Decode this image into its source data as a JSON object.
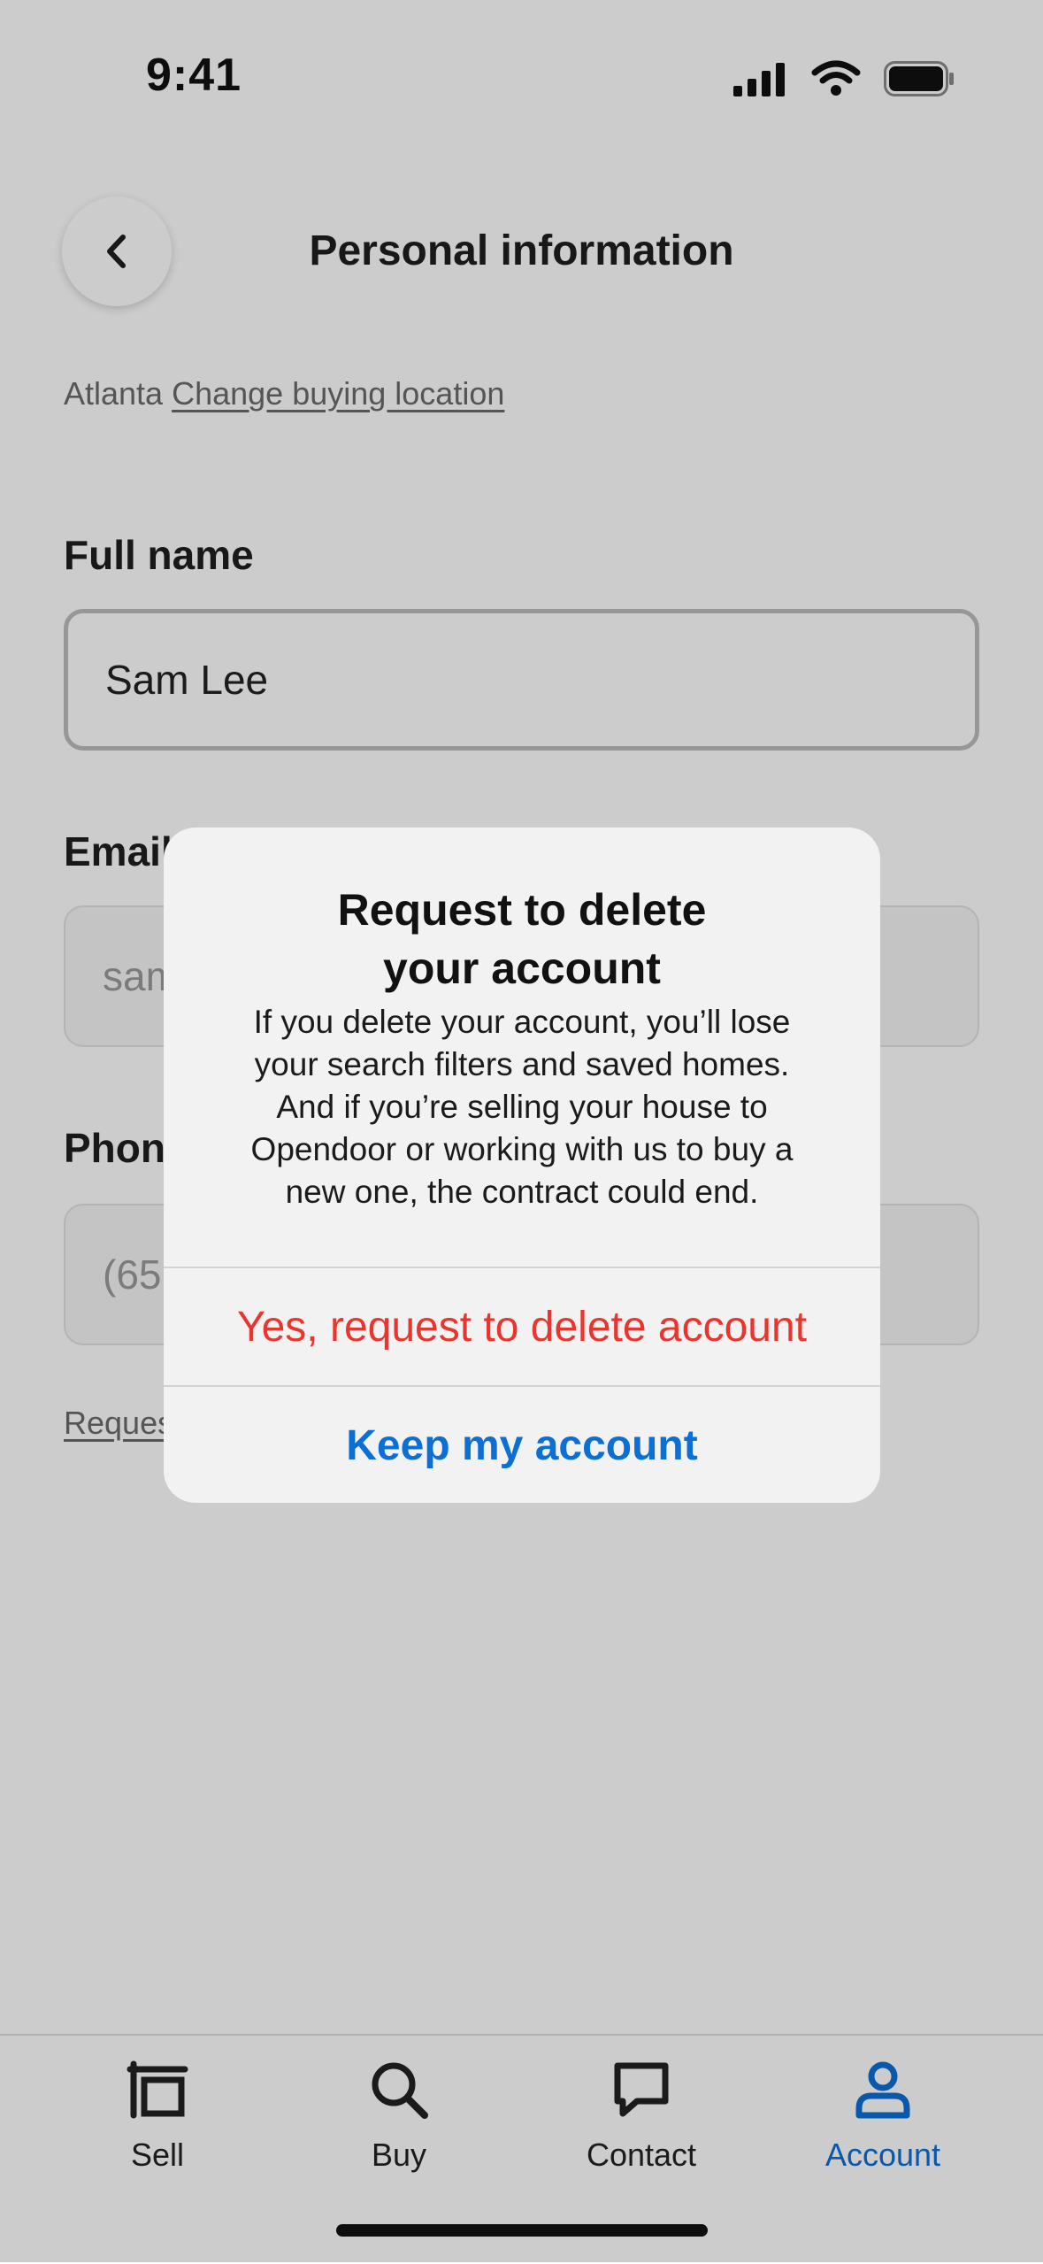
{
  "status_bar": {
    "time": "9:41",
    "icons": [
      "cellular-signal-icon",
      "wifi-icon",
      "battery-icon"
    ]
  },
  "header": {
    "back_icon": "chevron-left-icon",
    "title": "Personal information"
  },
  "location": {
    "city": "Atlanta",
    "change_link": "Change buying location"
  },
  "form": {
    "full_name": {
      "label": "Full name",
      "value": "Sam Lee"
    },
    "email": {
      "label": "Email",
      "value": "sam"
    },
    "phone": {
      "label": "Phone",
      "value": "(65"
    }
  },
  "request_link": "Reques",
  "tabs": [
    {
      "label": "Sell",
      "icon": "sell-icon",
      "active": false
    },
    {
      "label": "Buy",
      "icon": "search-icon",
      "active": false
    },
    {
      "label": "Contact",
      "icon": "chat-bubble-icon",
      "active": false
    },
    {
      "label": "Account",
      "icon": "person-icon",
      "active": true
    }
  ],
  "dialog": {
    "title_line1": "Request to delete",
    "title_line2": "your account",
    "message_lines": [
      "If you delete your account, you’ll lose",
      "your search filters and saved homes.",
      "And if you’re selling your house to",
      "Opendoor or working with us to buy a",
      "new one, the contract could end."
    ],
    "destructive_label": "Yes, request to delete account",
    "primary_label": "Keep my account"
  },
  "colors": {
    "accent_blue": "#0b6fd6",
    "destructive_red": "#e8352e",
    "overlay": "rgba(0,0,0,0.20)"
  }
}
